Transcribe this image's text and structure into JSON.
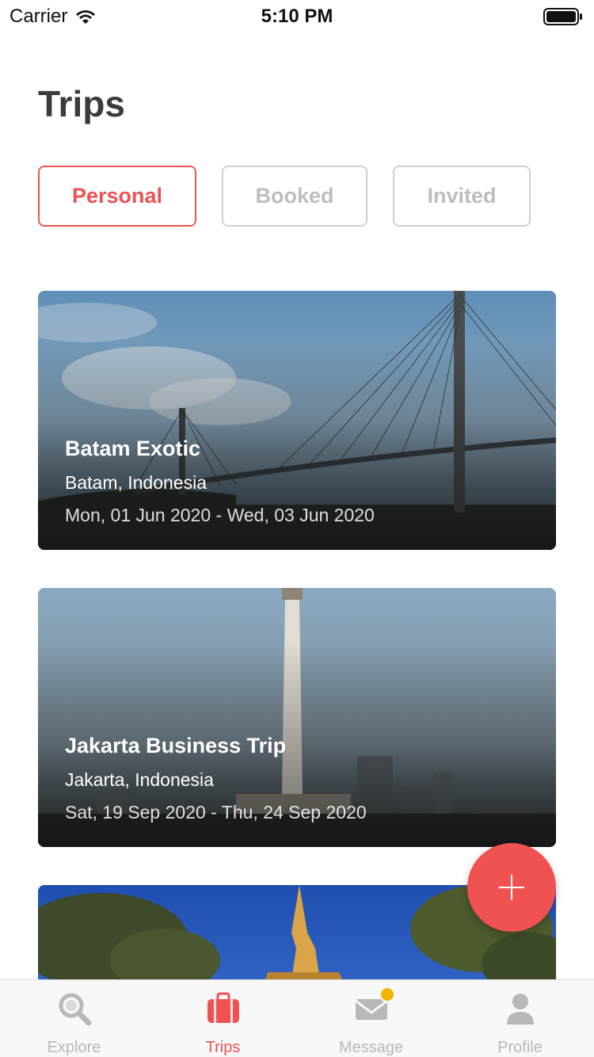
{
  "status_bar": {
    "carrier": "Carrier",
    "time": "5:10 PM"
  },
  "page": {
    "title": "Trips"
  },
  "filters": [
    {
      "label": "Personal",
      "active": true
    },
    {
      "label": "Booked",
      "active": false
    },
    {
      "label": "Invited",
      "active": false
    }
  ],
  "trips": [
    {
      "name": "Batam Exotic",
      "location": "Batam, Indonesia",
      "dates": "Mon, 01 Jun 2020 - Wed, 03 Jun 2020"
    },
    {
      "name": "Jakarta Business Trip",
      "location": "Jakarta, Indonesia",
      "dates": "Sat, 19 Sep 2020 - Thu, 24 Sep 2020"
    }
  ],
  "tab_bar": {
    "items": [
      {
        "label": "Explore",
        "icon": "search-icon",
        "active": false
      },
      {
        "label": "Trips",
        "icon": "suitcase-icon",
        "active": true
      },
      {
        "label": "Message",
        "icon": "envelope-icon",
        "active": false,
        "badge": true
      },
      {
        "label": "Profile",
        "icon": "person-icon",
        "active": false
      }
    ]
  },
  "colors": {
    "accent": "#f05252",
    "inactive": "#b8b8b8",
    "badge": "#f5b400"
  }
}
